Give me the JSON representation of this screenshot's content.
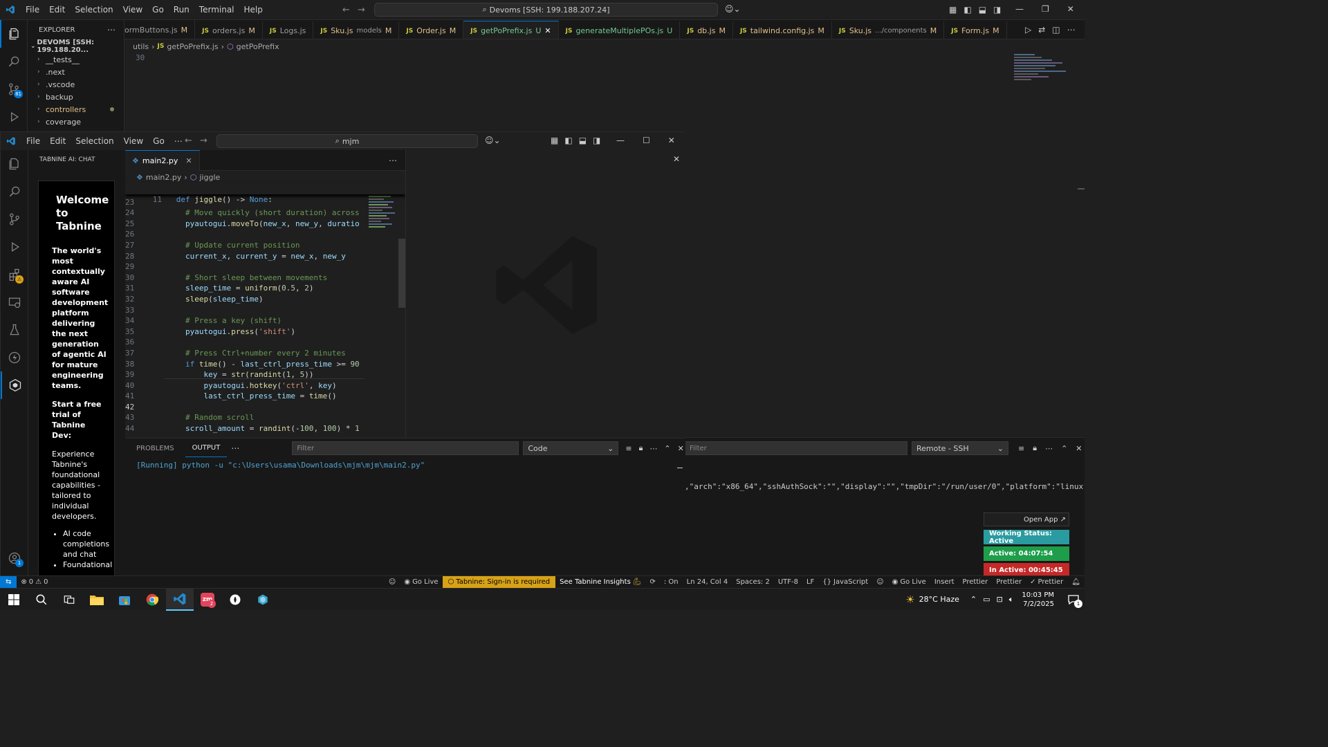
{
  "back_window": {
    "menu": [
      "File",
      "Edit",
      "Selection",
      "View",
      "Go",
      "Run",
      "Terminal",
      "Help"
    ],
    "command_center": "Devoms [SSH: 199.188.207.24]",
    "explorer_title": "EXPLORER",
    "workspace": "DEVOMS [SSH: 199.188.20...",
    "tree": [
      "__tests__",
      ".next",
      ".vscode",
      "backup",
      "controllers",
      "coverage"
    ],
    "source_control_badge": "81",
    "tabs": [
      {
        "name": "ormButtons.js",
        "status": "M"
      },
      {
        "name": "orders.js",
        "status": "M"
      },
      {
        "name": "Logs.js",
        "status": ""
      },
      {
        "name": "Sku.js",
        "desc": "models",
        "status": "M"
      },
      {
        "name": "Order.js",
        "status": "M"
      },
      {
        "name": "getPoPrefix.js",
        "status": "U",
        "active": true
      },
      {
        "name": "generateMultiplePOs.js",
        "status": "U"
      },
      {
        "name": "db.js",
        "status": "M"
      },
      {
        "name": "tailwind.config.js",
        "status": "M"
      },
      {
        "name": "Sku.js",
        "desc": ".../components",
        "status": "M"
      },
      {
        "name": "Form.js",
        "status": "M"
      }
    ],
    "breadcrumb": [
      "utils",
      "getPoPrefix.js",
      "getPoPrefix"
    ],
    "first_line_number": "30",
    "output_text": ",\"arch\":\"x86_64\",\"sshAuthSock\":\"\",\"display\":\"\",\"tmpDir\":\"/run/user/0\",\"platform\":\"linux\",",
    "output_filter_placeholder": "Filter",
    "output_channel": "Remote - SSH",
    "open_app": "Open App ↗",
    "working_status": "Working Status: Active",
    "active_time": "Active: 04:07:54",
    "inactive_time": "In Active: 00:45:45"
  },
  "front_window": {
    "menu": [
      "File",
      "Edit",
      "Selection",
      "View",
      "Go"
    ],
    "search": "mjm",
    "panel_title": "TABNINE AI: CHAT",
    "tabnine": {
      "title": "Welcome to Tabnine",
      "tagline": "The world's most contextually aware AI software development platform delivering the next generation of agentic AI for mature engineering teams.",
      "trial": "Start a free trial of Tabnine Dev:",
      "desc": "Experience Tabnine's foundational capabilities - tailored to individual developers.",
      "bullets": [
        "AI code completions and chat",
        "Foundational"
      ]
    },
    "editor_tab": "main2.py",
    "breadcrumb": [
      "main2.py",
      "jiggle"
    ],
    "sticky_line": {
      "num": "11",
      "code": "def jiggle() -> None:"
    },
    "lines": [
      {
        "n": "23",
        "t": ""
      },
      {
        "n": "24",
        "t": "# Move quickly (short duration) across"
      },
      {
        "n": "25",
        "t": "pyautogui.moveTo(new_x, new_y, duratio"
      },
      {
        "n": "26",
        "t": ""
      },
      {
        "n": "27",
        "t": "# Update current position"
      },
      {
        "n": "28",
        "t": "current_x, current_y = new_x, new_y"
      },
      {
        "n": "29",
        "t": ""
      },
      {
        "n": "30",
        "t": "# Short sleep between movements"
      },
      {
        "n": "31",
        "t": "sleep_time = uniform(0.5, 2)"
      },
      {
        "n": "32",
        "t": "sleep(sleep_time)"
      },
      {
        "n": "33",
        "t": ""
      },
      {
        "n": "34",
        "t": "# Press a key (shift)"
      },
      {
        "n": "35",
        "t": "pyautogui.press('shift')"
      },
      {
        "n": "36",
        "t": ""
      },
      {
        "n": "37",
        "t": "# Press Ctrl+number every 2 minutes"
      },
      {
        "n": "38",
        "t": "if time() - last_ctrl_press_time >= 90"
      },
      {
        "n": "39",
        "t": "    key = str(randint(1, 5))"
      },
      {
        "n": "40",
        "t": "    pyautogui.hotkey('ctrl', key)"
      },
      {
        "n": "41",
        "t": "    last_ctrl_press_time = time()"
      },
      {
        "n": "42",
        "t": ""
      },
      {
        "n": "43",
        "t": "# Random scroll"
      },
      {
        "n": "44",
        "t": "scroll_amount = randint(-100, 100) * 1"
      }
    ],
    "panel_tabs": [
      "PROBLEMS",
      "OUTPUT"
    ],
    "filter_placeholder": "Filter",
    "output_channel": "Code",
    "output_line": "[Running] python -u \"c:\\Users\\usama\\Downloads\\mjm\\mjm\\main2.py\""
  },
  "statusbar": {
    "errors": "0",
    "warnings": "0",
    "go_live": "Go Live",
    "tabnine": "Tabnine: Sign-in is required",
    "insights": "See Tabnine Insights",
    "on": ": On",
    "position": "Ln 24, Col 4",
    "spaces": "Spaces: 2",
    "encoding": "UTF-8",
    "eol": "LF",
    "language": "JavaScript",
    "go_live2": "Go Live",
    "insert": "Insert",
    "prettier1": "Prettier",
    "prettier2": "Prettier",
    "prettier3": "Prettier"
  },
  "taskbar": {
    "weather": "28°C  Haze",
    "time": "10:03 PM",
    "date": "7/2/2025",
    "zoom_badge": "2",
    "notif_badge": "1"
  },
  "colors": {
    "accent": "#0078d4",
    "tabnine_status": "#d7a217",
    "working": "#2a9ba0",
    "active": "#1e9e4a",
    "inactive": "#c62828"
  }
}
